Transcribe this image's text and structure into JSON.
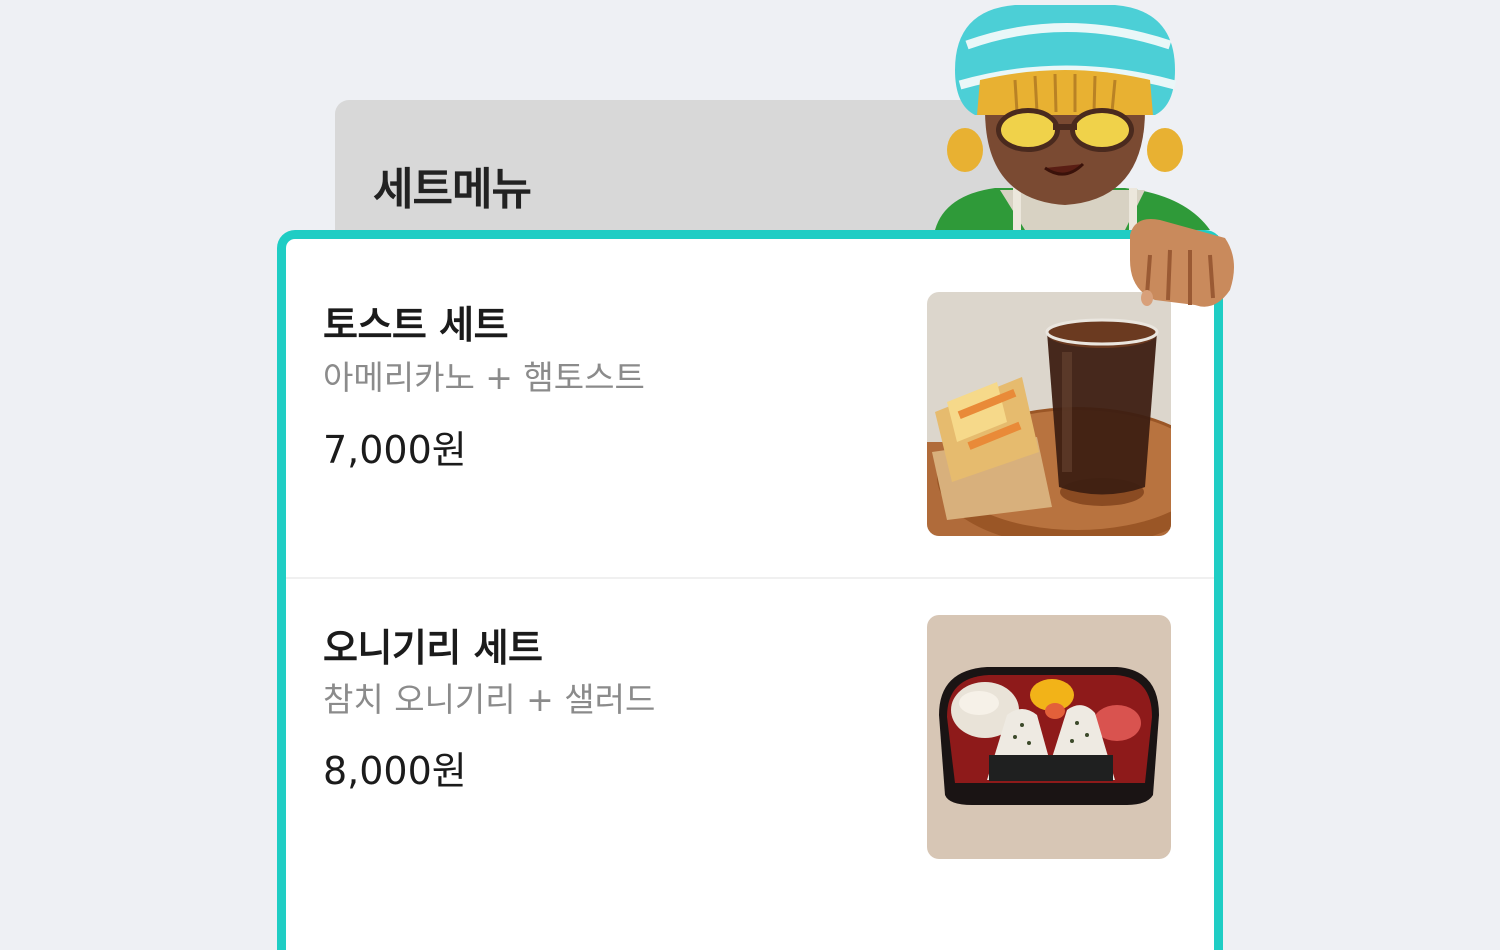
{
  "header": {
    "title": "세트메뉴"
  },
  "menu": {
    "items": [
      {
        "name": "토스트 세트",
        "description": "아메리카노 + 햄토스트",
        "price": "7,000원",
        "image": "toast-and-iced-americano-photo"
      },
      {
        "name": "오니기리 세트",
        "description": "참치 오니기리 + 샐러드",
        "price": "8,000원",
        "image": "onigiri-bento-photo"
      }
    ]
  },
  "mascot": {
    "icon": "cafe-staff-character-icon"
  },
  "colors": {
    "accent": "#1fcdc4",
    "background": "#eef0f4",
    "tab": "#d8d8d8",
    "muted_text": "#8b8b8b"
  }
}
